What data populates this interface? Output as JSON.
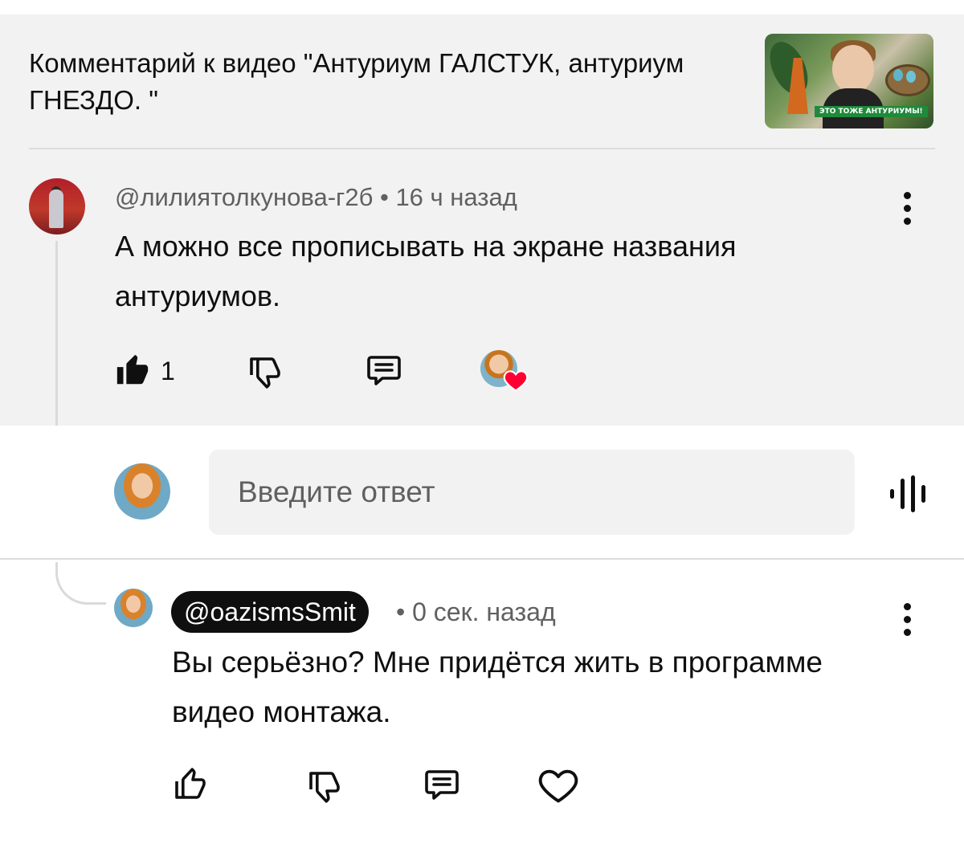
{
  "video": {
    "comment_on_label": "Комментарий к видео \"Антуриум ГАЛСТУК, антуриум ГНЕЗДО. \"",
    "thumbnail_caption": "ЭТО ТОЖЕ АНТУРИУМЫ!"
  },
  "comment": {
    "author": "@лилиятолкунова-г2б",
    "separator": "•",
    "time": "16 ч назад",
    "text": "А можно все прописывать на экране названия антуриумов.",
    "like_count": "1",
    "creator_heart": true
  },
  "reply_box": {
    "placeholder": "Введите ответ"
  },
  "reply": {
    "handle": "@oazismsSmit",
    "separator": "•",
    "time": "0 сек. назад",
    "text": "Вы серьёзно? Мне придётся жить в программе видео монтажа."
  },
  "colors": {
    "heart": "#ff0033",
    "text_primary": "#0f0f0f",
    "text_secondary": "#606060",
    "surface_gray": "#f2f2f2"
  },
  "icons": [
    "thumbs-up-filled-icon",
    "thumbs-down-icon",
    "reply-icon",
    "more-vert-icon",
    "mic-icon",
    "thumbs-up-icon",
    "heart-icon"
  ]
}
